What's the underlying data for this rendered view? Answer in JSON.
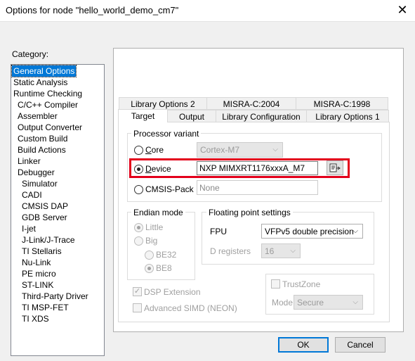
{
  "window": {
    "title": "Options for node \"hello_world_demo_cm7\"",
    "close": "✕"
  },
  "category": {
    "label": "Category:",
    "items": [
      "General Options",
      "Static Analysis",
      "Runtime Checking",
      "C/C++ Compiler",
      "Assembler",
      "Output Converter",
      "Custom Build",
      "Build Actions",
      "Linker",
      "Debugger",
      "Simulator",
      "CADI",
      "CMSIS DAP",
      "GDB Server",
      "I-jet",
      "J-Link/J-Trace",
      "TI Stellaris",
      "Nu-Link",
      "PE micro",
      "ST-LINK",
      "Third-Party Driver",
      "TI MSP-FET",
      "TI XDS"
    ],
    "selected": "General Options"
  },
  "tabs": {
    "row1": [
      "Library Options 2",
      "MISRA-C:2004",
      "MISRA-C:1998"
    ],
    "row2": [
      "Target",
      "Output",
      "Library Configuration",
      "Library Options 1"
    ]
  },
  "processor": {
    "group_label": "Processor variant",
    "core_label": "Core",
    "core_value": "Cortex-M7",
    "device_label": "Device",
    "device_value": "NXP MIMXRT1176xxxA_M7",
    "cmsis_label": "CMSIS-Pack",
    "cmsis_value": "None"
  },
  "endian": {
    "group_label": "Endian mode",
    "little": "Little",
    "big": "Big",
    "be32": "BE32",
    "be8": "BE8"
  },
  "fp": {
    "group_label": "Floating point settings",
    "fpu_label": "FPU",
    "fpu_value": "VFPv5 double precision",
    "dreg_label": "D registers",
    "dreg_value": "16"
  },
  "dsp_label": "DSP Extension",
  "simd_label": "Advanced SIMD (NEON)",
  "trustzone": {
    "label": "TrustZone",
    "mode_label": "Mode",
    "mode_value": "Secure"
  },
  "buttons": {
    "ok": "OK",
    "cancel": "Cancel"
  }
}
